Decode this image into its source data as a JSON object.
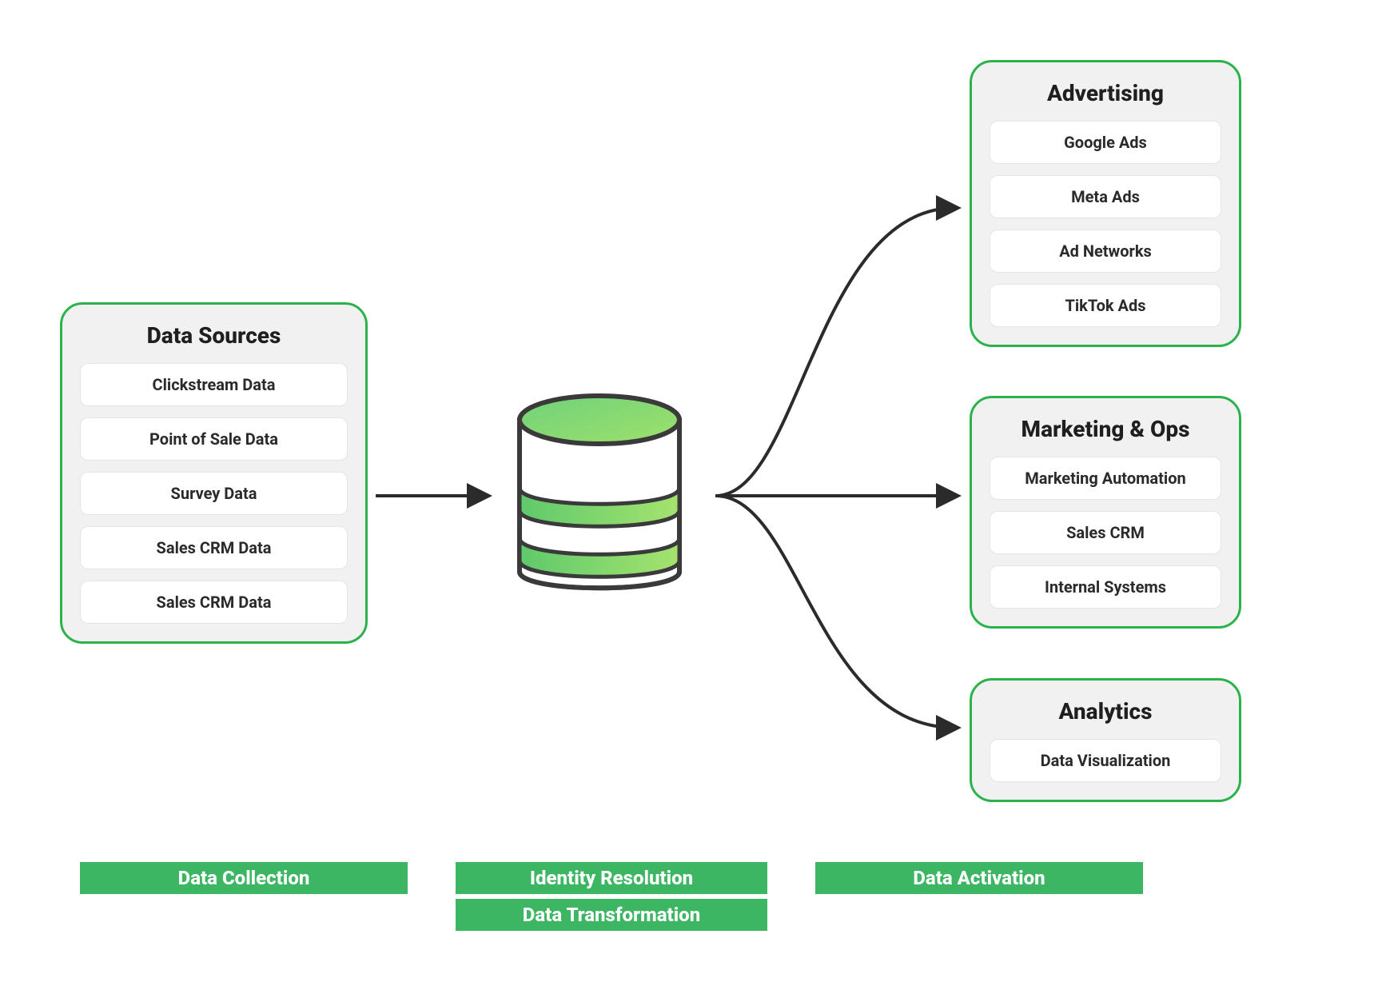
{
  "panels": {
    "sources": {
      "title": "Data Sources",
      "items": [
        "Clickstream Data",
        "Point of Sale Data",
        "Survey Data",
        "Sales CRM Data",
        "Sales CRM Data"
      ]
    },
    "advertising": {
      "title": "Advertising",
      "items": [
        "Google Ads",
        "Meta Ads",
        "Ad Networks",
        "TikTok Ads"
      ]
    },
    "marketing": {
      "title": "Marketing & Ops",
      "items": [
        "Marketing Automation",
        "Sales CRM",
        "Internal Systems"
      ]
    },
    "analytics": {
      "title": "Analytics",
      "items": [
        "Data Visualization"
      ]
    }
  },
  "footer": {
    "collection": "Data Collection",
    "identity": "Identity Resolution",
    "transform": "Data Transformation",
    "activation": "Data Activation"
  },
  "icons": {
    "database": "database-icon"
  }
}
